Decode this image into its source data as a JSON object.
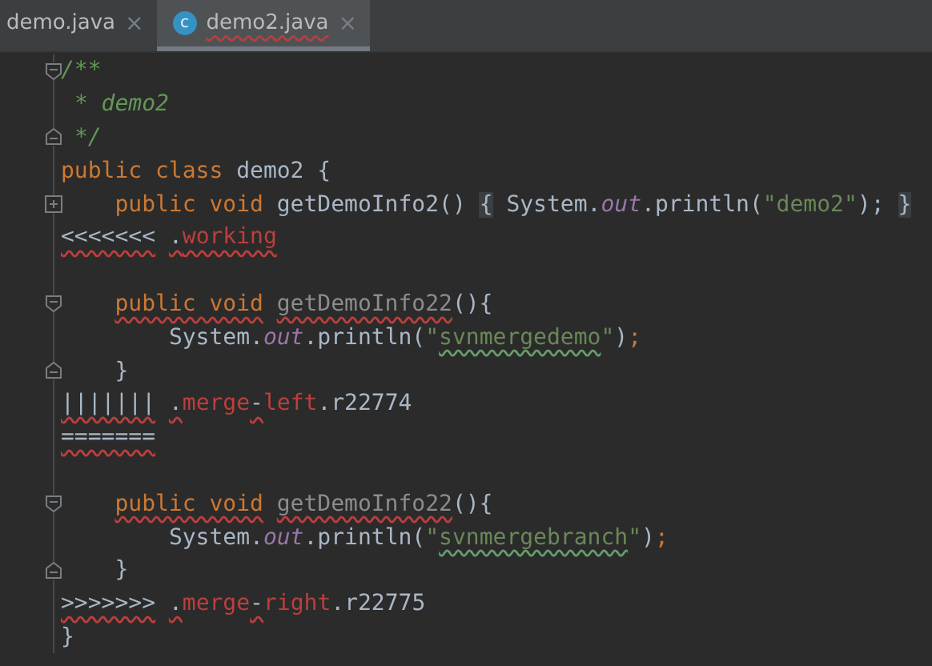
{
  "tabs": [
    {
      "label": "demo.java",
      "selected": false,
      "close": "×"
    },
    {
      "label": "demo2.java",
      "selected": true,
      "badge": "c",
      "close": "×",
      "error_underline": true
    }
  ],
  "lines": [
    {
      "fold_open": true,
      "tokens": [
        {
          "text": "/**",
          "kind": "comment"
        }
      ]
    },
    {
      "tokens": [
        {
          "text": " * demo2",
          "kind": "comment"
        }
      ]
    },
    {
      "fold_close": true,
      "tokens": [
        {
          "text": " */",
          "kind": "comment"
        }
      ]
    },
    {
      "tokens": [
        {
          "text": "public class ",
          "kind": "keyword"
        },
        {
          "text": "demo2 {",
          "kind": "plain"
        }
      ]
    },
    {
      "collapsed": true,
      "tokens": [
        {
          "text": "    public void ",
          "kind": "keyword"
        },
        {
          "text": "getDemoInfo2() ",
          "kind": "plain"
        },
        {
          "text": "{",
          "kind": "folded"
        },
        {
          "text": " System.",
          "kind": "plain"
        },
        {
          "text": "out",
          "kind": "field"
        },
        {
          "text": ".println(",
          "kind": "plain"
        },
        {
          "text": "\"demo2\"",
          "kind": "string"
        },
        {
          "text": "); ",
          "kind": "plain"
        },
        {
          "text": "}",
          "kind": "folded"
        }
      ]
    },
    {
      "tokens": [
        {
          "text": "<<<<<<<",
          "kind": "plain",
          "error_underline": true
        },
        {
          "text": " .",
          "kind": "plain",
          "error_underline": true
        },
        {
          "text": "working",
          "kind": "conflict",
          "error_underline": true
        }
      ]
    },
    {
      "blank": true
    },
    {
      "fold_open": true,
      "tokens": [
        {
          "text": "    public void ",
          "kind": "keyword",
          "error_underline": true
        },
        {
          "text": "getDemoInfo22",
          "kind": "unused",
          "error_underline": true
        },
        {
          "text": "(){",
          "kind": "plain"
        }
      ]
    },
    {
      "tokens": [
        {
          "text": "        System.",
          "kind": "plain"
        },
        {
          "text": "out",
          "kind": "field"
        },
        {
          "text": ".println(",
          "kind": "plain"
        },
        {
          "text": "\"",
          "kind": "string"
        },
        {
          "text": "svnmergedemo",
          "kind": "string",
          "typo_underline": true
        },
        {
          "text": "\"",
          "kind": "string"
        },
        {
          "text": ")",
          "kind": "plain"
        },
        {
          "text": ";",
          "kind": "keyword"
        }
      ]
    },
    {
      "fold_close": true,
      "tokens": [
        {
          "text": "    }",
          "kind": "plain"
        }
      ]
    },
    {
      "tokens": [
        {
          "text": "|||||||",
          "kind": "plain",
          "error_underline": true
        },
        {
          "text": " .",
          "kind": "plain",
          "error_underline": true
        },
        {
          "text": "merge",
          "kind": "conflict"
        },
        {
          "text": "-",
          "kind": "plain",
          "error_underline": true
        },
        {
          "text": "left",
          "kind": "conflict"
        },
        {
          "text": ".r22774",
          "kind": "plain"
        }
      ]
    },
    {
      "tokens": [
        {
          "text": "=======",
          "kind": "plain",
          "error_underline": true
        }
      ]
    },
    {
      "blank": true
    },
    {
      "fold_open": true,
      "tokens": [
        {
          "text": "    public void ",
          "kind": "keyword",
          "error_underline": true
        },
        {
          "text": "getDemoInfo22",
          "kind": "unused",
          "error_underline": true
        },
        {
          "text": "(){",
          "kind": "plain"
        }
      ]
    },
    {
      "tokens": [
        {
          "text": "        System.",
          "kind": "plain"
        },
        {
          "text": "out",
          "kind": "field"
        },
        {
          "text": ".println(",
          "kind": "plain"
        },
        {
          "text": "\"",
          "kind": "string"
        },
        {
          "text": "svnmergebranch",
          "kind": "string",
          "typo_underline": true
        },
        {
          "text": "\"",
          "kind": "string"
        },
        {
          "text": ")",
          "kind": "plain"
        },
        {
          "text": ";",
          "kind": "keyword"
        }
      ]
    },
    {
      "fold_close": true,
      "tokens": [
        {
          "text": "    }",
          "kind": "plain"
        }
      ]
    },
    {
      "tokens": [
        {
          "text": ">>>>>>>",
          "kind": "plain",
          "error_underline": true
        },
        {
          "text": " .",
          "kind": "plain",
          "error_underline": true
        },
        {
          "text": "merge",
          "kind": "conflict"
        },
        {
          "text": "-",
          "kind": "plain",
          "error_underline": true
        },
        {
          "text": "right",
          "kind": "conflict"
        },
        {
          "text": ".r22775",
          "kind": "plain"
        }
      ]
    },
    {
      "tokens": [
        {
          "text": "}",
          "kind": "plain"
        }
      ]
    }
  ]
}
